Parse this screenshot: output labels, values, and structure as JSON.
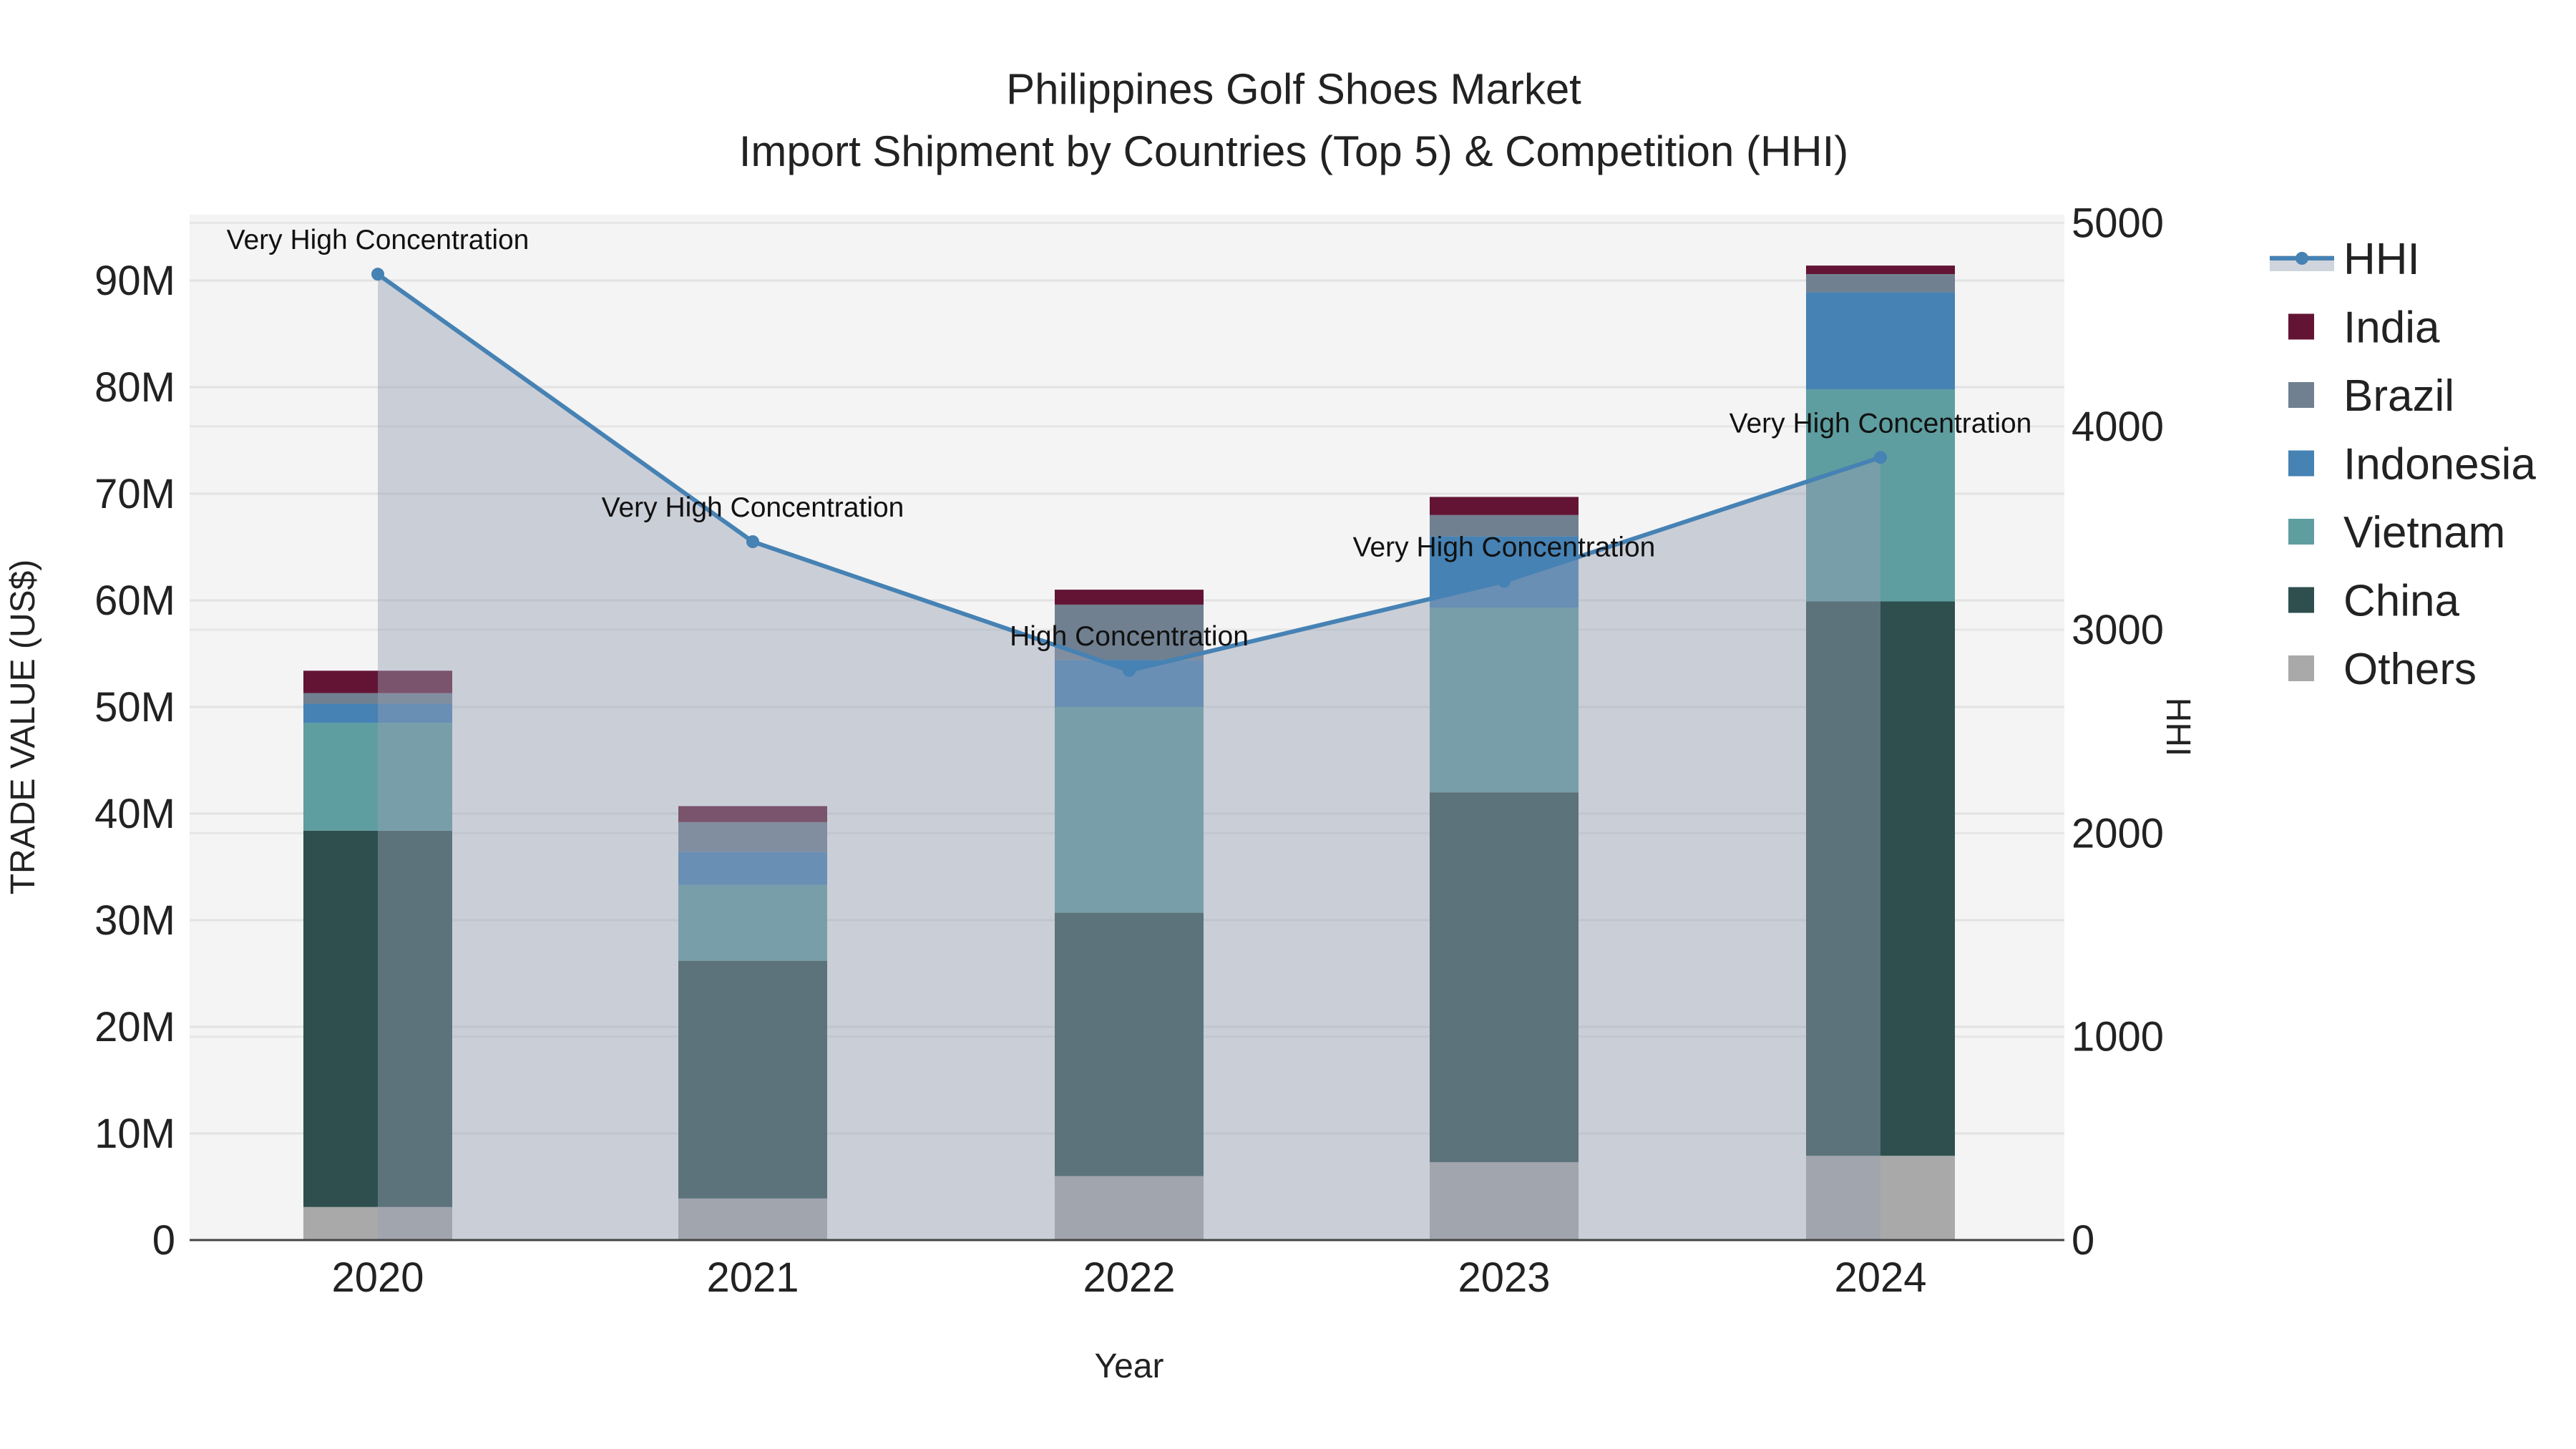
{
  "chart_data": {
    "type": "bar",
    "title": "Philippines Golf Shoes Market",
    "subtitle": "Import Shipment by Countries (Top 5) & Competition (HHI)",
    "xlabel": "Year",
    "ylabel": "TRADE VALUE (US$)",
    "y2label": "HHI",
    "categories": [
      "2020",
      "2021",
      "2022",
      "2023",
      "2024"
    ],
    "ylim": [
      0,
      96
    ],
    "y_unit": "M",
    "y_ticks": [
      0,
      10,
      20,
      30,
      40,
      50,
      60,
      70,
      80,
      90
    ],
    "y_tick_labels": [
      "0",
      "10M",
      "20M",
      "30M",
      "40M",
      "50M",
      "60M",
      "70M",
      "80M",
      "90M"
    ],
    "y2lim": [
      0,
      5100
    ],
    "y2_ticks": [
      0,
      1000,
      2000,
      3000,
      4000,
      5000
    ],
    "y2_tick_labels": [
      "0",
      "1000",
      "2000",
      "3000",
      "4000",
      "5000"
    ],
    "grid": true,
    "legend_position": "right",
    "stacked": true,
    "series": [
      {
        "name": "Others",
        "color": "#A9A9A9",
        "values": [
          3.1,
          3.9,
          6.0,
          7.3,
          7.9
        ]
      },
      {
        "name": "China",
        "color": "#2F4F4F",
        "values": [
          35.3,
          22.3,
          24.7,
          34.7,
          52.0
        ]
      },
      {
        "name": "Vietnam",
        "color": "#5F9EA0",
        "values": [
          10.1,
          7.1,
          19.3,
          17.3,
          19.9
        ]
      },
      {
        "name": "Indonesia",
        "color": "#4682B4",
        "values": [
          1.8,
          3.1,
          4.4,
          6.7,
          9.1
        ]
      },
      {
        "name": "Brazil",
        "color": "#708090",
        "values": [
          1.0,
          2.8,
          5.2,
          2.0,
          1.7
        ]
      },
      {
        "name": "India",
        "color": "#631434",
        "values": [
          2.1,
          1.5,
          1.4,
          1.7,
          0.8
        ]
      }
    ],
    "line": {
      "name": "HHI",
      "color": "#4682B4",
      "values": [
        4748,
        3433,
        2800,
        3238,
        3847
      ],
      "annotations": [
        "Very High Concentration",
        "Very High Concentration",
        "High Concentration",
        "Very High Concentration",
        "Very High Concentration"
      ]
    },
    "legend": [
      "HHI",
      "India",
      "Brazil",
      "Indonesia",
      "Vietnam",
      "China",
      "Others"
    ]
  }
}
